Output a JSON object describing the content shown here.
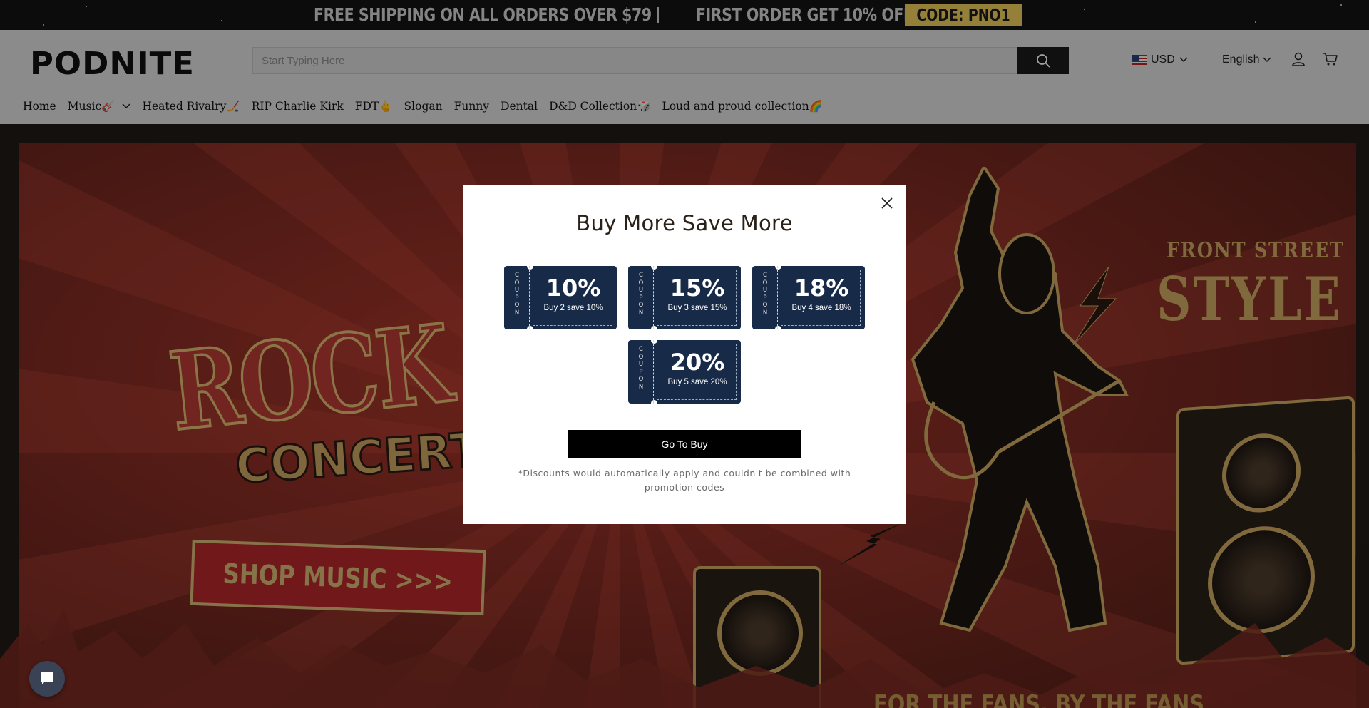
{
  "announcement": {
    "message_1": "FREE SHIPPING ON ALL ORDERS OVER $79",
    "message_2": "FIRST ORDER GET 10% OFF",
    "code": "CODE: PNO1"
  },
  "header": {
    "logo": "PODNITE",
    "search": {
      "placeholder": "Start Typing Here",
      "value": ""
    },
    "currency": "USD",
    "language": "English"
  },
  "nav": {
    "items": [
      {
        "label": "Home"
      },
      {
        "label": "Music🎸"
      },
      {
        "label": "Heated Rivalry🏒"
      },
      {
        "label": "RIP Charlie Kirk"
      },
      {
        "label": "FDT🖕"
      },
      {
        "label": "Slogan"
      },
      {
        "label": "Funny"
      },
      {
        "label": "Dental"
      },
      {
        "label": "D&D Collection🎲"
      },
      {
        "label": "Loud and proud collection🌈"
      }
    ]
  },
  "hero": {
    "headline": "ROCK & ROLL",
    "subheadline": "CONCERT",
    "cta": "SHOP MUSIC >>>",
    "tag_small": "FRONT STREET",
    "tag_large": "STYLE",
    "footer_text": "FOR THE FANS, BY THE FANS"
  },
  "modal": {
    "title": "Buy More Save More",
    "coupon_stub": "COUPON",
    "coupons": [
      {
        "percent": "10%",
        "text": "Buy 2 save 10%"
      },
      {
        "percent": "15%",
        "text": "Buy 3 save 15%"
      },
      {
        "percent": "18%",
        "text": "Buy 4 save 18%"
      },
      {
        "percent": "20%",
        "text": "Buy 5 save 20%"
      }
    ],
    "button": "Go To Buy",
    "disclaimer": "*Discounts would automatically apply and couldn't be combined with promotion codes"
  },
  "icons": {
    "search": "search-icon",
    "account": "user-icon",
    "cart": "cart-icon",
    "close": "close-icon",
    "chat": "chat-icon"
  },
  "colors": {
    "coupon_bg": "#172a48",
    "code_bg": "#e8c85a",
    "hero_red": "#a8362a",
    "gold": "#c9a560"
  }
}
